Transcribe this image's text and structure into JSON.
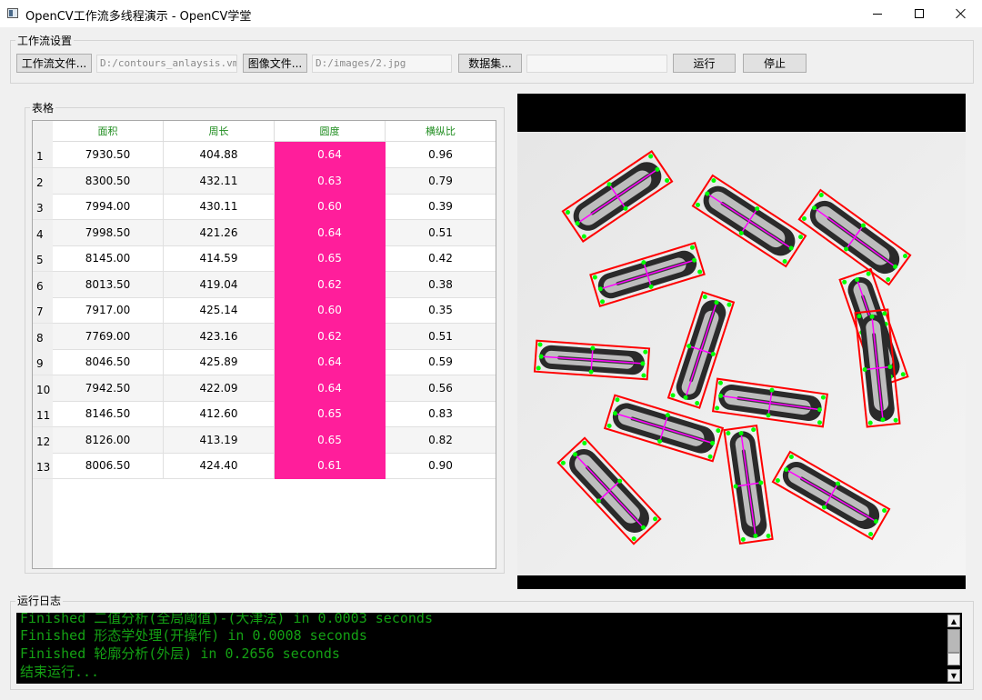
{
  "window": {
    "title": "OpenCV工作流多线程演示 - OpenCV学堂"
  },
  "settings": {
    "group_label": "工作流设置",
    "workflow_button": "工作流文件...",
    "workflow_path": "D:/contours_anlaysis.vm",
    "image_button": "图像文件...",
    "image_path": "D:/images/2.jpg",
    "dataset_button": "数据集...",
    "dataset_path": "",
    "run_button": "运行",
    "stop_button": "停止"
  },
  "table": {
    "group_label": "表格",
    "columns": [
      "面积",
      "周长",
      "圆度",
      "横纵比"
    ],
    "highlight_color": "#ff1e9b",
    "rows": [
      {
        "n": "1",
        "area": "7930.50",
        "perimeter": "404.88",
        "circularity": "0.64",
        "aspect": "0.96"
      },
      {
        "n": "2",
        "area": "8300.50",
        "perimeter": "432.11",
        "circularity": "0.63",
        "aspect": "0.79"
      },
      {
        "n": "3",
        "area": "7994.00",
        "perimeter": "430.11",
        "circularity": "0.60",
        "aspect": "0.39"
      },
      {
        "n": "4",
        "area": "7998.50",
        "perimeter": "421.26",
        "circularity": "0.64",
        "aspect": "0.51"
      },
      {
        "n": "5",
        "area": "8145.00",
        "perimeter": "414.59",
        "circularity": "0.65",
        "aspect": "0.42"
      },
      {
        "n": "6",
        "area": "8013.50",
        "perimeter": "419.04",
        "circularity": "0.62",
        "aspect": "0.38"
      },
      {
        "n": "7",
        "area": "7917.00",
        "perimeter": "425.14",
        "circularity": "0.60",
        "aspect": "0.35"
      },
      {
        "n": "8",
        "area": "7769.00",
        "perimeter": "423.16",
        "circularity": "0.62",
        "aspect": "0.51"
      },
      {
        "n": "9",
        "area": "8046.50",
        "perimeter": "425.89",
        "circularity": "0.64",
        "aspect": "0.59"
      },
      {
        "n": "10",
        "area": "7942.50",
        "perimeter": "422.09",
        "circularity": "0.64",
        "aspect": "0.56"
      },
      {
        "n": "11",
        "area": "8146.50",
        "perimeter": "412.60",
        "circularity": "0.65",
        "aspect": "0.83"
      },
      {
        "n": "12",
        "area": "8126.00",
        "perimeter": "413.19",
        "circularity": "0.65",
        "aspect": "0.82"
      },
      {
        "n": "13",
        "area": "8006.50",
        "perimeter": "424.40",
        "circularity": "0.61",
        "aspect": "0.90"
      }
    ]
  },
  "log": {
    "group_label": "运行日志",
    "lines": [
      "Finished 二值分析(全局阈值)-(大津法) in 0.0003 seconds",
      "Finished 形态学处理(开操作) in 0.0008 seconds",
      "Finished 轮廓分析(外层) in 0.2656 seconds",
      "结束运行..."
    ]
  },
  "colors": {
    "log_text": "#14a014",
    "header_text": "#1e8c1e",
    "contour_box": "#ff0000",
    "axis_line": "#ff00ff",
    "corner_point": "#00ff00"
  }
}
